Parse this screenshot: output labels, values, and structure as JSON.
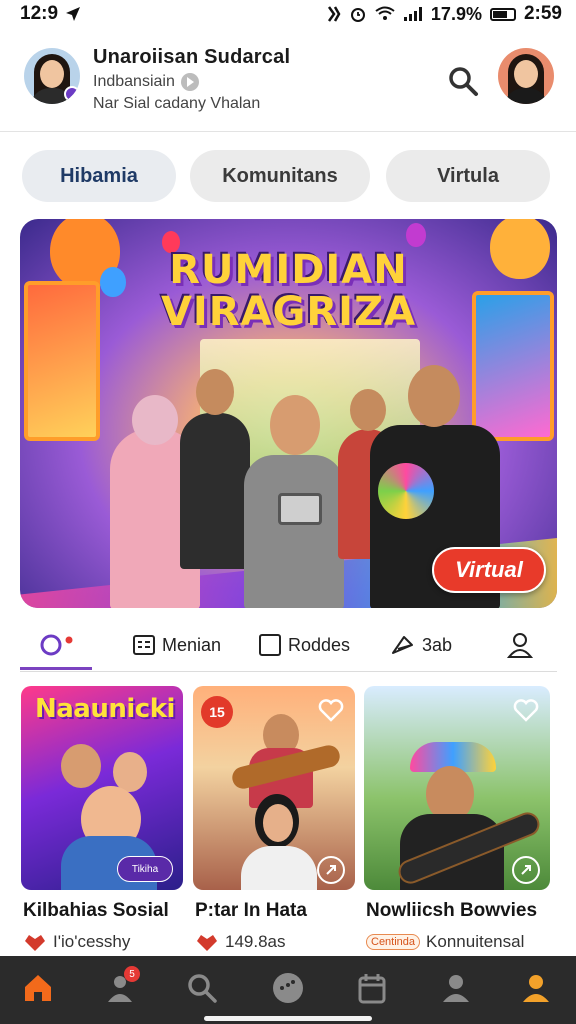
{
  "status_bar": {
    "time_left": "12:9",
    "battery": "17.9%",
    "time_right": "2:59"
  },
  "header": {
    "name": "Unaroiisan Sudarcal",
    "subtitle": "Indbansiain",
    "description": "Nar Sial cadany Vhalan"
  },
  "chips": [
    {
      "label": "Hibamia",
      "active": true
    },
    {
      "label": "Komunitans",
      "active": false
    },
    {
      "label": "Virtula",
      "active": false
    }
  ],
  "hero": {
    "title_line1": "RUMIDIAN",
    "title_line2": "VIRAGRIZA",
    "button_label": "Virtual"
  },
  "subtabs": [
    {
      "label": "",
      "icon": "circle-dot-icon",
      "active": true
    },
    {
      "label": "Menian",
      "icon": "tag-icon"
    },
    {
      "label": "Roddes",
      "icon": "square-icon"
    },
    {
      "label": "3ab",
      "icon": "send-icon"
    },
    {
      "label": "",
      "icon": "person-outline-icon"
    }
  ],
  "cards": [
    {
      "heading": "Naaunicki",
      "title": "Kilbahias Sosial",
      "meta": "I'io'cesshy",
      "pill": "Tikiha"
    },
    {
      "title": "P:tar In Hata",
      "meta": "149.8as",
      "badge": "15"
    },
    {
      "title": "Nowliicsh Bowvies",
      "badge": "Centinda",
      "meta": "Konnuitensal"
    }
  ],
  "bottom_nav": {
    "items": [
      "home-icon",
      "notification-person-icon",
      "search-icon",
      "chat-icon",
      "calendar-icon",
      "profile-icon",
      "account-icon"
    ],
    "notification_count": "5"
  },
  "colors": {
    "accent_purple": "#7b43c0",
    "hero_button": "#e83a2a",
    "nav_bg": "#2b2b2b",
    "nav_active": "#f26a1b"
  }
}
